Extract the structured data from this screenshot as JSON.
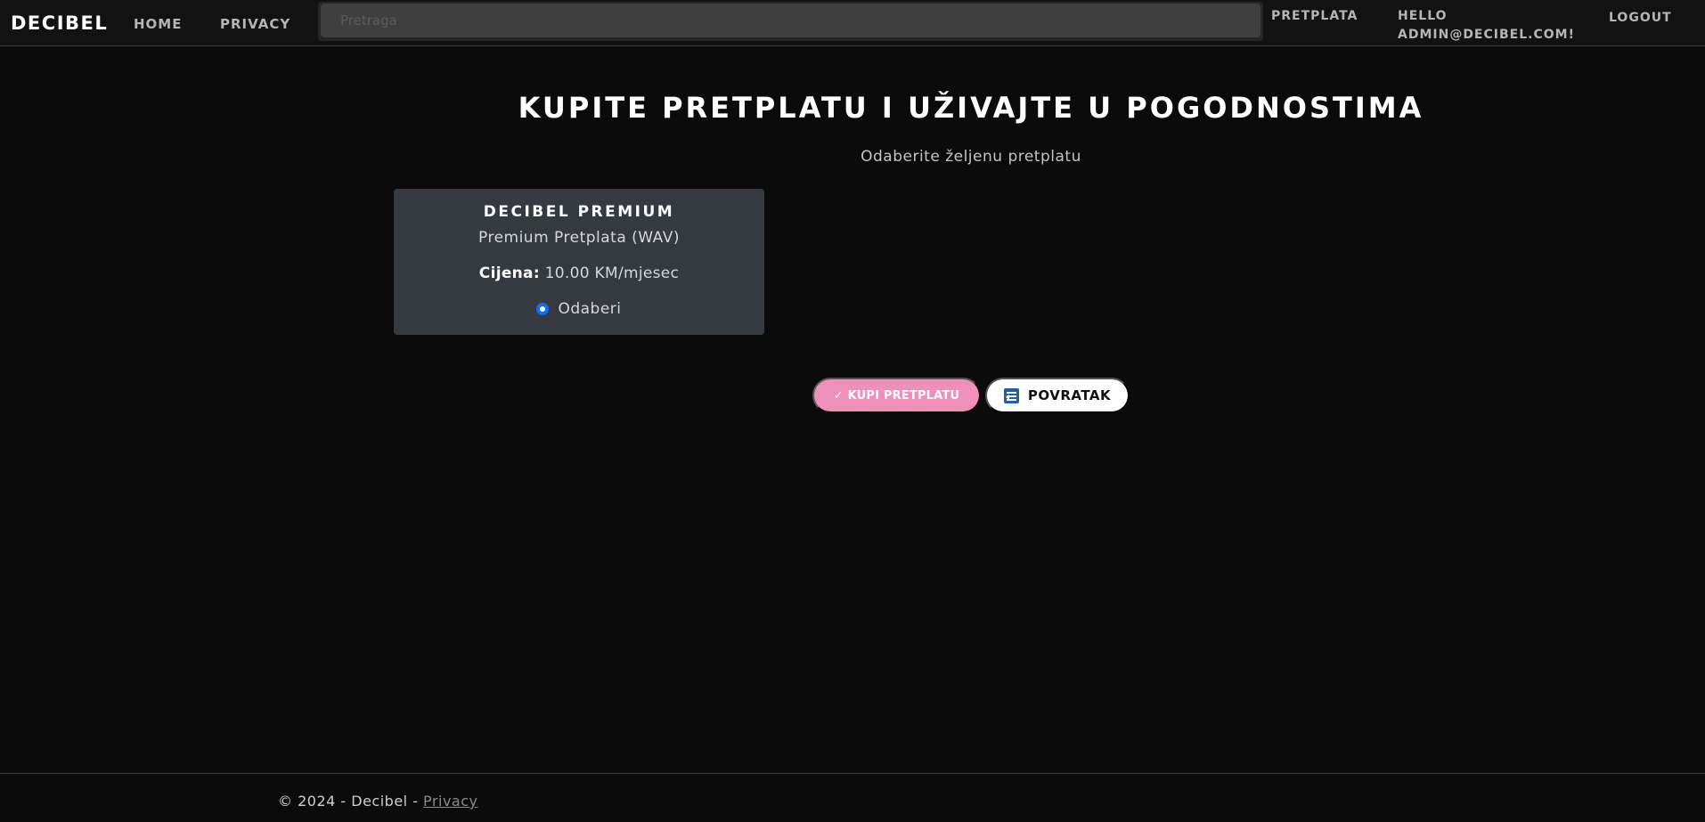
{
  "navbar": {
    "brand": "DECIBEL",
    "links": {
      "home": "HOME",
      "privacy": "PRIVACY"
    },
    "search": {
      "placeholder": "Pretraga",
      "value": ""
    },
    "pretplata": "PRETPLATA",
    "hello": "HELLO ADMIN@DECIBEL.COM!",
    "logout": "LOGOUT"
  },
  "main": {
    "title": "KUPITE PRETPLATU I UŽIVAJTE U POGODNOSTIMA",
    "subtitle": "Odaberite željenu pretplatu"
  },
  "plan": {
    "name": "DECIBEL PREMIUM",
    "description": "Premium Pretplata (WAV)",
    "price_label": "Cijena:",
    "price_value": "10.00 KM/mjesec",
    "select_label": "Odaberi",
    "selected": true
  },
  "buttons": {
    "buy": "✓ KUPI PRETPLATU",
    "back": "POVRATAK"
  },
  "footer": {
    "copyright": "© 2024 - Decibel - ",
    "privacy_link": "Privacy"
  },
  "colors": {
    "background": "#0b0b0b",
    "card": "#353a40",
    "buy_button": "#f08fba",
    "radio_accent": "#0d6efd"
  },
  "icons": {
    "back_button_icon": "back-list-icon",
    "buy_button_icon": "checkmark-icon"
  }
}
